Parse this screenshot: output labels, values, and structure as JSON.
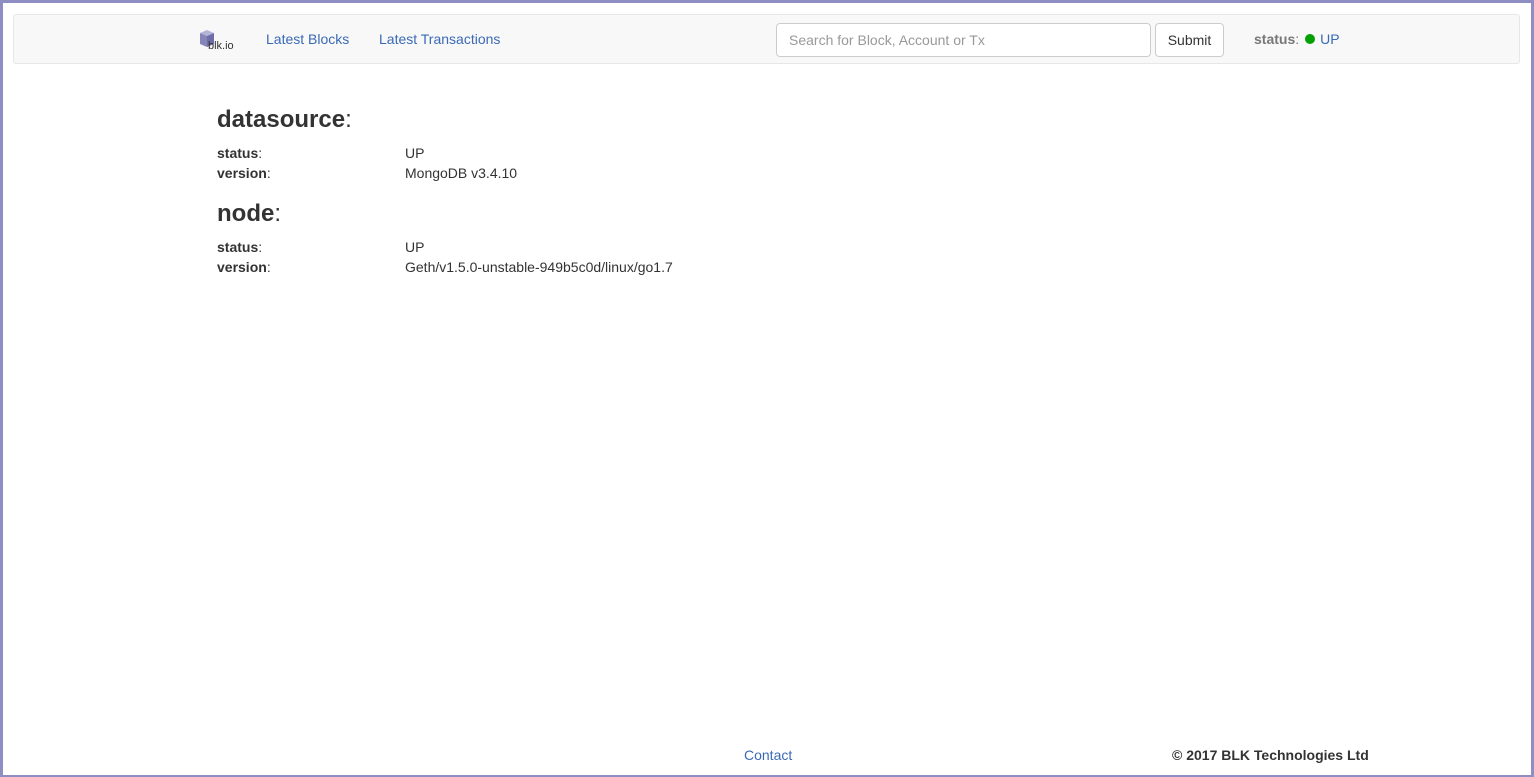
{
  "header": {
    "logo_text": "blk.io",
    "nav": {
      "latest_blocks": "Latest Blocks",
      "latest_transactions": "Latest Transactions"
    },
    "search": {
      "placeholder": "Search for Block, Account or Tx",
      "value": "",
      "submit_label": "Submit"
    },
    "status": {
      "label": "status",
      "colon": ":",
      "value": "UP",
      "indicator_color": "#00a000"
    }
  },
  "sections": [
    {
      "title": "datasource",
      "rows": [
        {
          "key": "status",
          "value": "UP"
        },
        {
          "key": "version",
          "value": "MongoDB v3.4.10"
        }
      ]
    },
    {
      "title": "node",
      "rows": [
        {
          "key": "status",
          "value": "UP"
        },
        {
          "key": "version",
          "value": "Geth/v1.5.0-unstable-949b5c0d/linux/go1.7"
        }
      ]
    }
  ],
  "footer": {
    "contact": "Contact",
    "copyright": "© 2017 BLK Technologies Ltd"
  },
  "colors": {
    "link": "#3b6ab4",
    "window_border": "#8e8ec2",
    "navbar_bg": "#f8f8f8"
  }
}
